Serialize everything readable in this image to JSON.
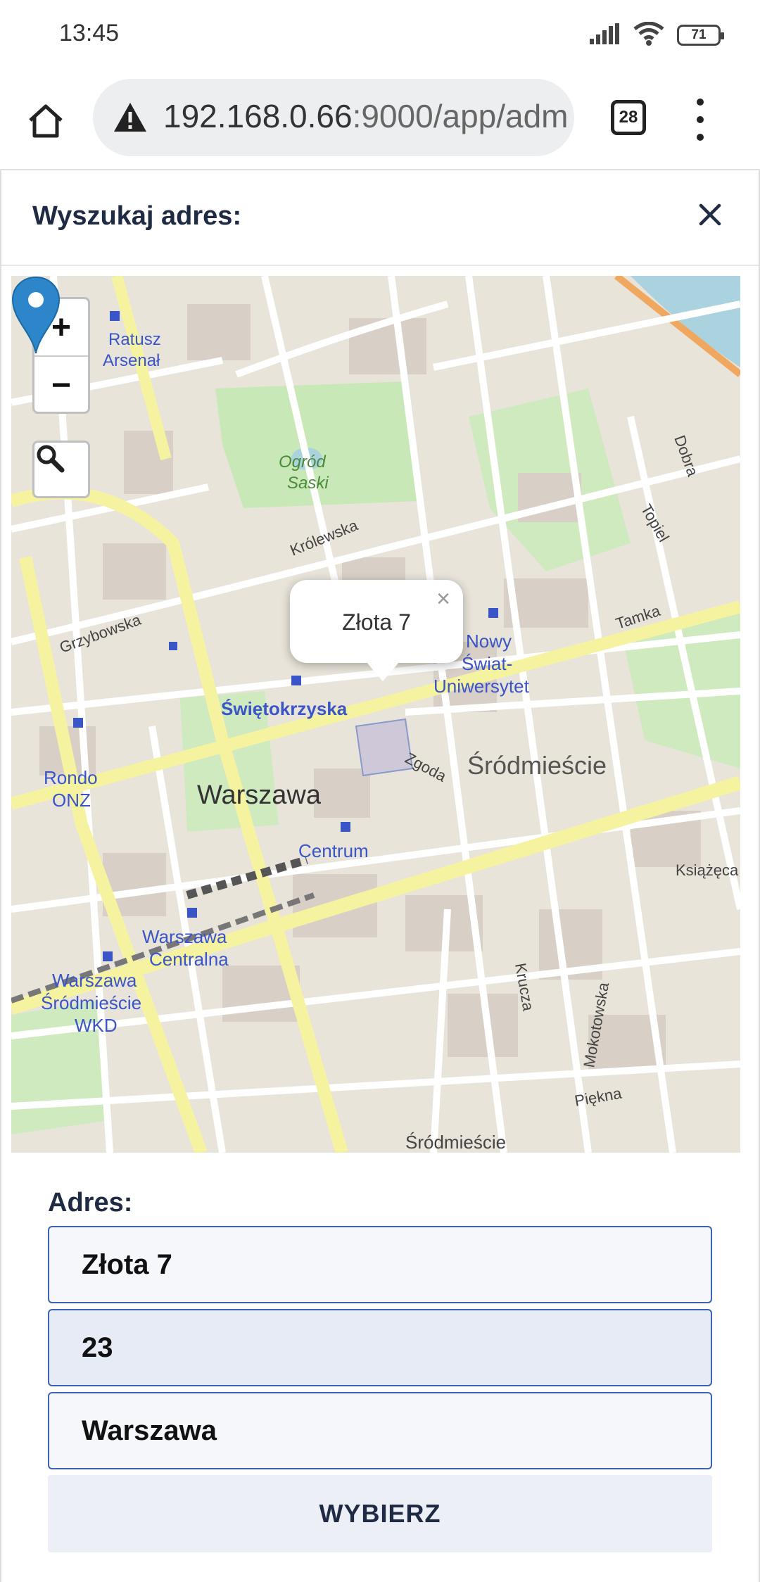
{
  "status_bar": {
    "time": "13:45",
    "battery": "71",
    "icons": [
      "signal-icon",
      "wifi-icon",
      "battery-icon"
    ]
  },
  "browser": {
    "url_host": "192.168.0.66",
    "url_rest": ":9000/app/adm",
    "tab_count": "28",
    "icons": [
      "home-icon",
      "warning-icon",
      "tabs-icon",
      "more-vert-icon"
    ]
  },
  "dialog": {
    "title": "Wyszukaj adres:",
    "close_icon": "close-icon"
  },
  "map": {
    "zoom_in": "+",
    "zoom_out": "−",
    "search_icon": "search-icon",
    "popup_text": "Złota 7",
    "popup_close": "×",
    "labels": {
      "ratusz": "Ratusz",
      "arsenal": "Arsenał",
      "ogrod": "Ogród",
      "saski": "Saski",
      "krolewska": "Królewska",
      "grzybowska": "Grzybowska",
      "swietokrzyska": "Świętokrzyska",
      "nowy": "Nowy",
      "swiat": "Świat-",
      "uniwersytet": "Uniwersytet",
      "rondo": "Rondo",
      "onz": "ONZ",
      "warszawa": "Warszawa",
      "srodmiescie": "Śródmieście",
      "zgoda": "Zgoda",
      "centrum": "Centrum",
      "ksiazeca": "Książęca",
      "warszawa_centralna_1": "Warszawa",
      "warszawa_centralna_2": "Centralna",
      "wkd_1": "Warszawa",
      "wkd_2": "Śródmieście",
      "wkd_3": "WKD",
      "krucza": "Krucza",
      "mokotowska": "Mokotowska",
      "piekna": "Piękna",
      "srodmiescie_bottom": "Śródmieście",
      "dobra": "Dobra",
      "topiel": "Topiel",
      "tamka": "Tamka"
    },
    "colors": {
      "background": "#e9e4da",
      "park": "#c9e8b8",
      "road": "#ffffff",
      "major_road": "#f6f3a0",
      "rail": "#888888",
      "water": "#aad3df",
      "label_blue": "#3a55c6",
      "marker": "#2c86c9"
    }
  },
  "form": {
    "label": "Adres:",
    "street": "Złota 7",
    "number": "23",
    "city": "Warszawa",
    "submit": "WYBIERZ"
  }
}
